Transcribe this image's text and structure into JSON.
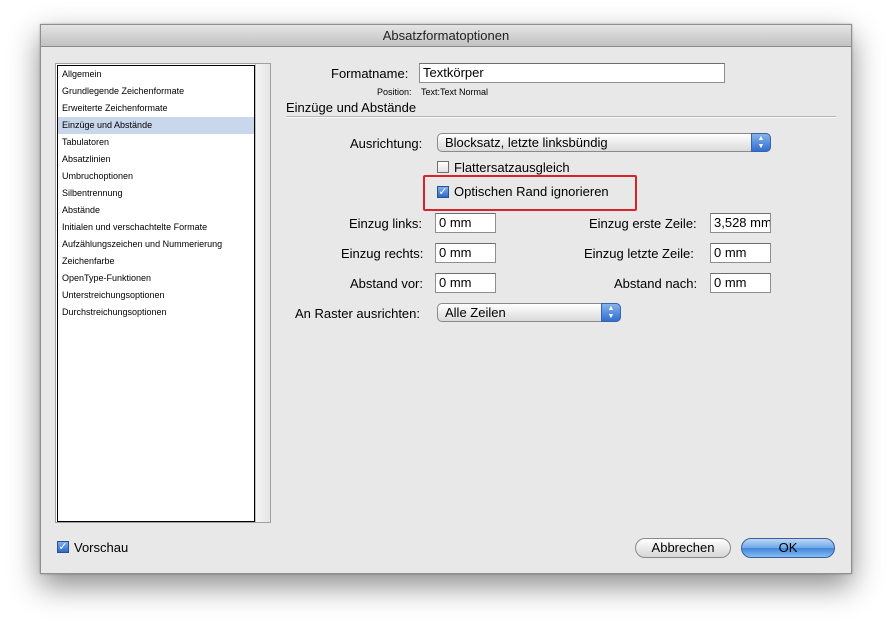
{
  "window": {
    "title": "Absatzformatoptionen"
  },
  "sidebar": {
    "items": [
      {
        "label": "Allgemein",
        "selected": false
      },
      {
        "label": "Grundlegende Zeichenformate",
        "selected": false
      },
      {
        "label": "Erweiterte Zeichenformate",
        "selected": false
      },
      {
        "label": "Einzüge und Abstände",
        "selected": true
      },
      {
        "label": "Tabulatoren",
        "selected": false
      },
      {
        "label": "Absatzlinien",
        "selected": false
      },
      {
        "label": "Umbruchoptionen",
        "selected": false
      },
      {
        "label": "Silbentrennung",
        "selected": false
      },
      {
        "label": "Abstände",
        "selected": false
      },
      {
        "label": "Initialen und verschachtelte Formate",
        "selected": false
      },
      {
        "label": "Aufzählungszeichen und Nummerierung",
        "selected": false
      },
      {
        "label": "Zeichenfarbe",
        "selected": false
      },
      {
        "label": "OpenType-Funktionen",
        "selected": false
      },
      {
        "label": "Unterstreichungsoptionen",
        "selected": false
      },
      {
        "label": "Durchstreichungsoptionen",
        "selected": false
      }
    ]
  },
  "format": {
    "name_label": "Formatname:",
    "name_value": "Textkörper",
    "position_label": "Position:",
    "position_value": "Text:Text Normal"
  },
  "section": {
    "title": "Einzüge und Abstände"
  },
  "alignment": {
    "label": "Ausrichtung:",
    "value": "Blocksatz, letzte linksbündig"
  },
  "options": {
    "flattersatz_label": "Flattersatzausgleich",
    "flattersatz_checked": false,
    "optical_margin_label": "Optischen Rand ignorieren",
    "optical_margin_checked": true
  },
  "fields": {
    "indent_left_label": "Einzug links:",
    "indent_left_value": "0 mm",
    "indent_right_label": "Einzug rechts:",
    "indent_right_value": "0 mm",
    "space_before_label": "Abstand vor:",
    "space_before_value": "0 mm",
    "first_line_label": "Einzug erste Zeile:",
    "first_line_value": "3,528 mm",
    "last_line_label": "Einzug letzte Zeile:",
    "last_line_value": "0 mm",
    "space_after_label": "Abstand nach:",
    "space_after_value": "0 mm"
  },
  "grid": {
    "label": "An Raster ausrichten:",
    "value": "Alle Zeilen"
  },
  "footer": {
    "preview_label": "Vorschau",
    "preview_checked": true,
    "cancel_label": "Abbrechen",
    "ok_label": "OK"
  },
  "colors": {
    "highlight_border": "#d8232a",
    "selection": "#c9d7ec",
    "accent": "#3f86dc"
  }
}
